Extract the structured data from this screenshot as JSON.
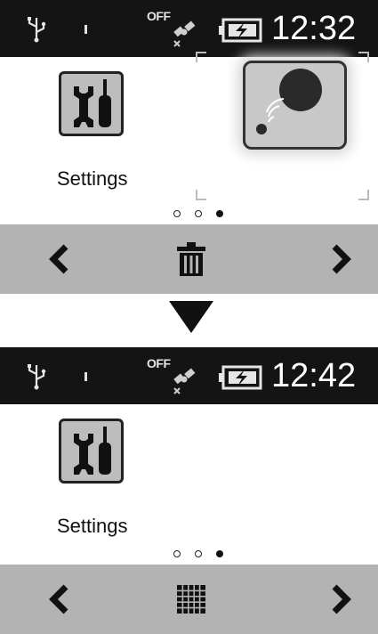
{
  "colors": {
    "status_bar_bg": "#141414",
    "soft_bar_bg": "#b3b3b3",
    "icon_tile_bg": "#bdbdbd",
    "background": "#ffffff"
  },
  "top_screen": {
    "status": {
      "gps_state": "OFF",
      "time": "12:32",
      "icons": [
        "usb-icon",
        "signal-icon",
        "gps-satellite-icon",
        "battery-charging-icon"
      ]
    },
    "apps": [
      {
        "name": "Settings",
        "icon": "settings-tools-icon"
      },
      {
        "name": "",
        "icon": "remote-control-icon",
        "selected": true
      }
    ],
    "pager": {
      "page_count": 3,
      "current_page": 3
    },
    "soft_keys": {
      "left": "chevron-left-icon",
      "center": "trash-icon",
      "right": "chevron-right-icon"
    }
  },
  "transition": {
    "icon": "down-arrow-icon"
  },
  "bottom_screen": {
    "status": {
      "gps_state": "OFF",
      "time": "12:42",
      "icons": [
        "usb-icon",
        "signal-icon",
        "gps-satellite-icon",
        "battery-charging-icon"
      ]
    },
    "apps": [
      {
        "name": "Settings",
        "icon": "settings-tools-icon"
      }
    ],
    "pager": {
      "page_count": 3,
      "current_page": 3
    },
    "soft_keys": {
      "left": "chevron-left-icon",
      "center": "app-grid-icon",
      "right": "chevron-right-icon"
    }
  }
}
